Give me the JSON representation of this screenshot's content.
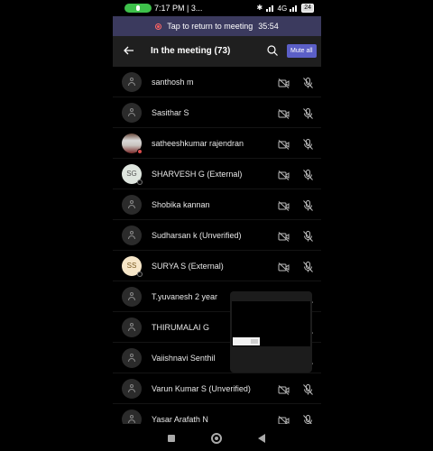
{
  "status_bar": {
    "time": "7:17 PM | 3...",
    "network": "4G",
    "battery": "24"
  },
  "banner": {
    "label": "Tap to return to meeting",
    "timer": "35:54"
  },
  "header": {
    "title": "In the meeting (73)",
    "mute_all": "Mute all"
  },
  "participants": [
    {
      "name": "santhosh m",
      "avatar": "default"
    },
    {
      "name": "Sasithar S",
      "avatar": "default"
    },
    {
      "name": "satheeshkumar rajendran",
      "avatar": "photo"
    },
    {
      "name": "SHARVESH G (External)",
      "avatar": "initials",
      "initials": "SG"
    },
    {
      "name": "Shobika kannan",
      "avatar": "default"
    },
    {
      "name": "Sudharsan k (Unverified)",
      "avatar": "default"
    },
    {
      "name": "SURYA S (External)",
      "avatar": "initials",
      "initials": "SS"
    },
    {
      "name": "T.yuvanesh 2 year",
      "avatar": "default"
    },
    {
      "name": "THIRUMALAI G",
      "avatar": "default"
    },
    {
      "name": "Vaiishnavi Senthil",
      "avatar": "default"
    },
    {
      "name": "Varun Kumar S  (Unverified)",
      "avatar": "default"
    },
    {
      "name": "Yasar Arafath N",
      "avatar": "default"
    }
  ],
  "colors": {
    "accent": "#5b5fc7",
    "banner": "#3b3a5e",
    "header": "#1f1f1f",
    "status_green": "#3ec14b"
  }
}
